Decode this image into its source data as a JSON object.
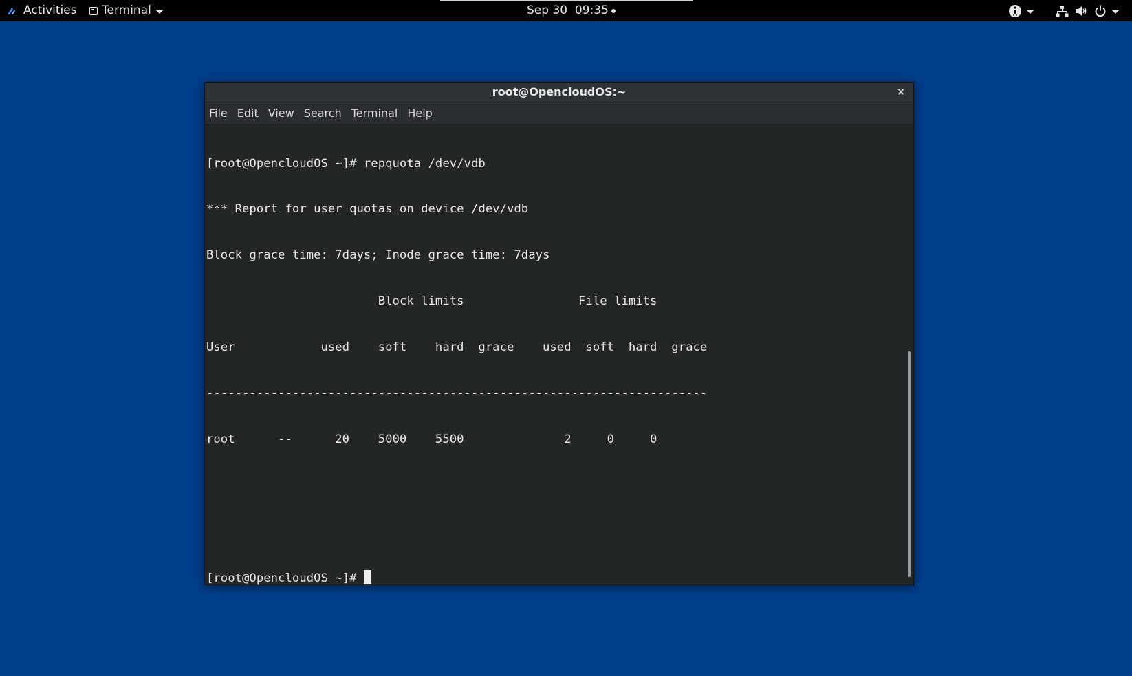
{
  "topbar": {
    "activities": "Activities",
    "app_name": "Terminal",
    "datetime": "Sep 30  09:35"
  },
  "window": {
    "title": "root@OpencloudOS:~",
    "close_label": "×",
    "menu": [
      "File",
      "Edit",
      "View",
      "Search",
      "Terminal",
      "Help"
    ]
  },
  "terminal": {
    "lines": [
      "[root@OpencloudOS ~]# repquota /dev/vdb",
      "*** Report for user quotas on device /dev/vdb",
      "Block grace time: 7days; Inode grace time: 7days",
      "                        Block limits                File limits",
      "User            used    soft    hard  grace    used  soft  hard  grace",
      "----------------------------------------------------------------------",
      "root      --      20    5000    5500              2     0     0",
      "",
      ""
    ],
    "prompt": "[root@OpencloudOS ~]# "
  },
  "scrollbar": {
    "position_fraction": 0.5,
    "visible_fraction": 0.49
  },
  "colors": {
    "desktop": "#003e8a",
    "topbar": "#000000",
    "terminal_bg": "#232627",
    "terminal_fg": "#e6e6e6"
  }
}
